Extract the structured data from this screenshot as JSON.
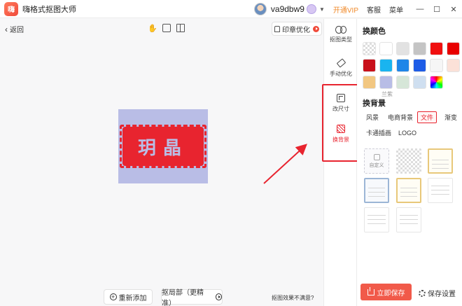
{
  "app": {
    "title": "嗨格式抠图大师",
    "logo_text": "嗨"
  },
  "user": {
    "name": "va9dbw9"
  },
  "titlebar": {
    "vip_link": "开通VIP",
    "service": "客服",
    "menu": "菜单",
    "minimize_glyph": "—",
    "maximize_glyph": "☐",
    "close_glyph": "✕",
    "caret_glyph": "▼"
  },
  "canvas": {
    "back_label": "返回",
    "back_glyph": "‹",
    "hand_glyph": "✋",
    "seal_optimize": "印章优化",
    "seal_text": "玥晶",
    "add_again": "重新添加",
    "refine": "抠局部（更精准）",
    "unsatisfied": "抠图效果不满意?",
    "plus_glyph": "+"
  },
  "tools": [
    {
      "label": "抠图类型",
      "icon": "cutout-type-icon"
    },
    {
      "label": "手动优化",
      "icon": "eraser-icon"
    },
    {
      "label": "改尺寸",
      "icon": "resize-icon"
    },
    {
      "label": "换背景",
      "icon": "background-icon",
      "active": true
    }
  ],
  "panel": {
    "color_title": "换颜色",
    "swatch_label": "兰紫",
    "swatches": [
      "transparent",
      "#ffffff",
      "#e2e2e2",
      "#c4c4c4",
      "#f01010",
      "#e80000",
      "#c8101a",
      "#19b4f0",
      "#1f86e8",
      "#1e5ce6",
      "#f6f6f6",
      "#fbe1d8",
      "#f2c781",
      "#b8bde6",
      "#d6e6d8",
      "#cfdff0",
      "rainbow"
    ],
    "bg_title": "换背景",
    "categories": [
      {
        "label": "风景",
        "active": false
      },
      {
        "label": "电商背景",
        "active": false
      },
      {
        "label": "文件",
        "active": true
      },
      {
        "label": "渐变",
        "active": false
      },
      {
        "label": "卡通插画",
        "active": false
      },
      {
        "label": "LOGO",
        "active": false
      }
    ],
    "custom_label": "自定义",
    "save_now": "立即保存",
    "save_settings": "保存设置"
  },
  "colors": {
    "accent": "#e8242f",
    "save_button": "#f15a4a",
    "vip": "#f08a2a",
    "preview_bg": "#b9bde6"
  }
}
